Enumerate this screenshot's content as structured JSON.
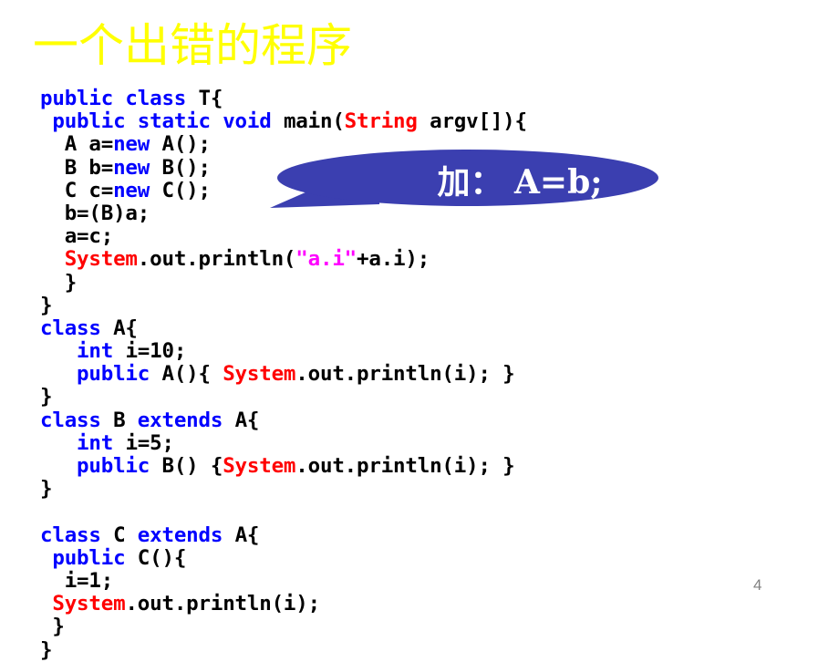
{
  "slide": {
    "title": "一个出错的程序",
    "page_number": "4",
    "background_color": "#ffffff",
    "title_color": "#ffff00",
    "page_number_color": "#808080"
  },
  "callout": {
    "text": "加： A=b;",
    "shape": "ellipse-with-pointer-tail",
    "fill_color": "#3b3fb0",
    "text_color": "#ffffff"
  },
  "code": {
    "keyword_color": "#0000ff",
    "type_color": "#ff0000",
    "string_color": "#ff00ff",
    "plain_color": "#000000",
    "lines": [
      [
        {
          "t": "public class ",
          "c": "kw"
        },
        {
          "t": "T{",
          "c": "pln"
        }
      ],
      [
        {
          "t": " ",
          "c": "pln"
        },
        {
          "t": "public static void ",
          "c": "kw"
        },
        {
          "t": "main(",
          "c": "pln"
        },
        {
          "t": "String",
          "c": "typ"
        },
        {
          "t": " argv[]){",
          "c": "pln"
        }
      ],
      [
        {
          "t": "  A a=",
          "c": "pln"
        },
        {
          "t": "new",
          "c": "kw"
        },
        {
          "t": " A();",
          "c": "pln"
        }
      ],
      [
        {
          "t": "  B b=",
          "c": "pln"
        },
        {
          "t": "new",
          "c": "kw"
        },
        {
          "t": " B();",
          "c": "pln"
        }
      ],
      [
        {
          "t": "  C c=",
          "c": "pln"
        },
        {
          "t": "new",
          "c": "kw"
        },
        {
          "t": " C();",
          "c": "pln"
        }
      ],
      [
        {
          "t": "  b=(B)a;",
          "c": "pln"
        }
      ],
      [
        {
          "t": "  a=c;",
          "c": "pln"
        }
      ],
      [
        {
          "t": "  ",
          "c": "pln"
        },
        {
          "t": "System",
          "c": "typ"
        },
        {
          "t": ".out.println(",
          "c": "pln"
        },
        {
          "t": "\"a.i\"",
          "c": "str"
        },
        {
          "t": "+a.i);",
          "c": "pln"
        }
      ],
      [
        {
          "t": "  }",
          "c": "pln"
        }
      ],
      [
        {
          "t": "}",
          "c": "pln"
        }
      ],
      [
        {
          "t": "class",
          "c": "kw"
        },
        {
          "t": " A{",
          "c": "pln"
        }
      ],
      [
        {
          "t": "   ",
          "c": "pln"
        },
        {
          "t": "int",
          "c": "kw"
        },
        {
          "t": " i=10;",
          "c": "pln"
        }
      ],
      [
        {
          "t": "   ",
          "c": "pln"
        },
        {
          "t": "public",
          "c": "kw"
        },
        {
          "t": " A(){ ",
          "c": "pln"
        },
        {
          "t": "System",
          "c": "typ"
        },
        {
          "t": ".out.println(i); }",
          "c": "pln"
        }
      ],
      [
        {
          "t": "}",
          "c": "pln"
        }
      ],
      [
        {
          "t": "class",
          "c": "kw"
        },
        {
          "t": " B ",
          "c": "pln"
        },
        {
          "t": "extends",
          "c": "kw"
        },
        {
          "t": " A{",
          "c": "pln"
        }
      ],
      [
        {
          "t": "   ",
          "c": "pln"
        },
        {
          "t": "int",
          "c": "kw"
        },
        {
          "t": " i=5;",
          "c": "pln"
        }
      ],
      [
        {
          "t": "   ",
          "c": "pln"
        },
        {
          "t": "public",
          "c": "kw"
        },
        {
          "t": " B() {",
          "c": "pln"
        },
        {
          "t": "System",
          "c": "typ"
        },
        {
          "t": ".out.println(i); }",
          "c": "pln"
        }
      ],
      [
        {
          "t": "}",
          "c": "pln"
        }
      ],
      [],
      [
        {
          "t": "class",
          "c": "kw"
        },
        {
          "t": " C ",
          "c": "pln"
        },
        {
          "t": "extends",
          "c": "kw"
        },
        {
          "t": " A{",
          "c": "pln"
        }
      ],
      [
        {
          "t": " ",
          "c": "pln"
        },
        {
          "t": "public",
          "c": "kw"
        },
        {
          "t": " C(){",
          "c": "pln"
        }
      ],
      [
        {
          "t": "  i=1;",
          "c": "pln"
        }
      ],
      [
        {
          "t": " ",
          "c": "pln"
        },
        {
          "t": "System",
          "c": "typ"
        },
        {
          "t": ".out.println(i);",
          "c": "pln"
        }
      ],
      [
        {
          "t": " }",
          "c": "pln"
        }
      ],
      [
        {
          "t": "}",
          "c": "pln"
        }
      ]
    ]
  }
}
